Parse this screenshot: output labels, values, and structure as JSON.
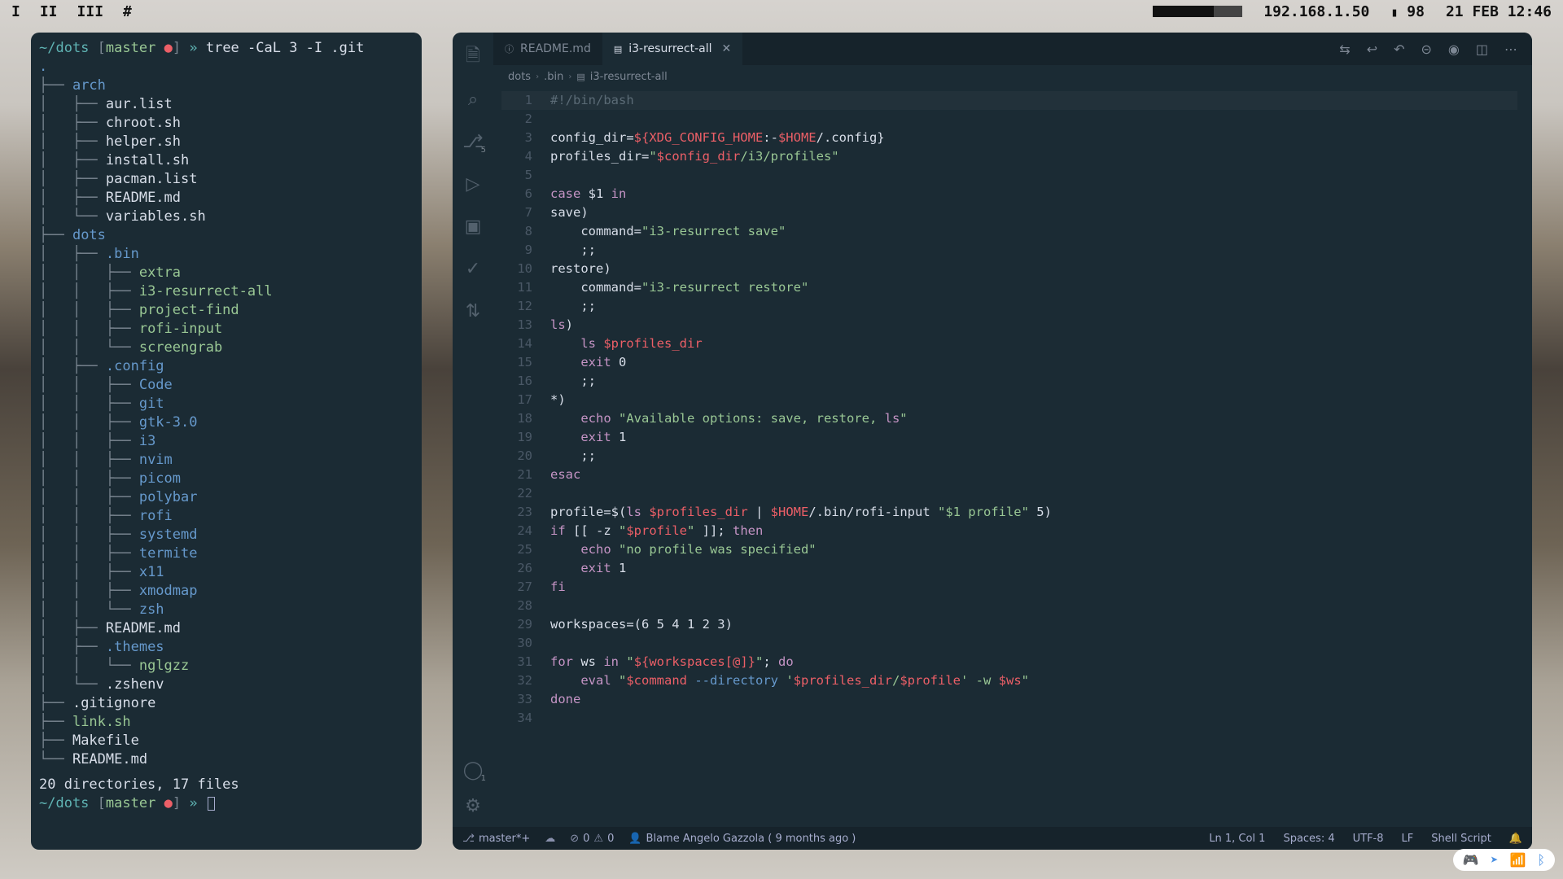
{
  "topbar": {
    "workspaces": [
      "I",
      "II",
      "III",
      "#"
    ],
    "ip": "192.168.1.50",
    "battery": "98",
    "datetime": "21 FEB 12:46"
  },
  "terminal": {
    "prompt_path": "~/dots",
    "branch": "master",
    "command": "tree -CaL 3 -I .git",
    "tree": [
      {
        "d": 0,
        "t": ".",
        "c": "blue"
      },
      {
        "d": 0,
        "t": "├── ",
        "c": "grey",
        "n": "arch",
        "nc": "blue"
      },
      {
        "d": 1,
        "t": "│   ├── ",
        "c": "grey",
        "n": "aur.list",
        "nc": "white"
      },
      {
        "d": 1,
        "t": "│   ├── ",
        "c": "grey",
        "n": "chroot.sh",
        "nc": "white"
      },
      {
        "d": 1,
        "t": "│   ├── ",
        "c": "grey",
        "n": "helper.sh",
        "nc": "white"
      },
      {
        "d": 1,
        "t": "│   ├── ",
        "c": "grey",
        "n": "install.sh",
        "nc": "white"
      },
      {
        "d": 1,
        "t": "│   ├── ",
        "c": "grey",
        "n": "pacman.list",
        "nc": "white"
      },
      {
        "d": 1,
        "t": "│   ├── ",
        "c": "grey",
        "n": "README.md",
        "nc": "white"
      },
      {
        "d": 1,
        "t": "│   └── ",
        "c": "grey",
        "n": "variables.sh",
        "nc": "white"
      },
      {
        "d": 0,
        "t": "├── ",
        "c": "grey",
        "n": "dots",
        "nc": "blue"
      },
      {
        "d": 1,
        "t": "│   ├── ",
        "c": "grey",
        "n": ".bin",
        "nc": "blue"
      },
      {
        "d": 2,
        "t": "│   │   ├── ",
        "c": "grey",
        "n": "extra",
        "nc": "green"
      },
      {
        "d": 2,
        "t": "│   │   ├── ",
        "c": "grey",
        "n": "i3-resurrect-all",
        "nc": "green"
      },
      {
        "d": 2,
        "t": "│   │   ├── ",
        "c": "grey",
        "n": "project-find",
        "nc": "green"
      },
      {
        "d": 2,
        "t": "│   │   ├── ",
        "c": "grey",
        "n": "rofi-input",
        "nc": "green"
      },
      {
        "d": 2,
        "t": "│   │   └── ",
        "c": "grey",
        "n": "screengrab",
        "nc": "green"
      },
      {
        "d": 1,
        "t": "│   ├── ",
        "c": "grey",
        "n": ".config",
        "nc": "blue"
      },
      {
        "d": 2,
        "t": "│   │   ├── ",
        "c": "grey",
        "n": "Code",
        "nc": "blue"
      },
      {
        "d": 2,
        "t": "│   │   ├── ",
        "c": "grey",
        "n": "git",
        "nc": "blue"
      },
      {
        "d": 2,
        "t": "│   │   ├── ",
        "c": "grey",
        "n": "gtk-3.0",
        "nc": "blue"
      },
      {
        "d": 2,
        "t": "│   │   ├── ",
        "c": "grey",
        "n": "i3",
        "nc": "blue"
      },
      {
        "d": 2,
        "t": "│   │   ├── ",
        "c": "grey",
        "n": "nvim",
        "nc": "blue"
      },
      {
        "d": 2,
        "t": "│   │   ├── ",
        "c": "grey",
        "n": "picom",
        "nc": "blue"
      },
      {
        "d": 2,
        "t": "│   │   ├── ",
        "c": "grey",
        "n": "polybar",
        "nc": "blue"
      },
      {
        "d": 2,
        "t": "│   │   ├── ",
        "c": "grey",
        "n": "rofi",
        "nc": "blue"
      },
      {
        "d": 2,
        "t": "│   │   ├── ",
        "c": "grey",
        "n": "systemd",
        "nc": "blue"
      },
      {
        "d": 2,
        "t": "│   │   ├── ",
        "c": "grey",
        "n": "termite",
        "nc": "blue"
      },
      {
        "d": 2,
        "t": "│   │   ├── ",
        "c": "grey",
        "n": "x11",
        "nc": "blue"
      },
      {
        "d": 2,
        "t": "│   │   ├── ",
        "c": "grey",
        "n": "xmodmap",
        "nc": "blue"
      },
      {
        "d": 2,
        "t": "│   │   └── ",
        "c": "grey",
        "n": "zsh",
        "nc": "blue"
      },
      {
        "d": 1,
        "t": "│   ├── ",
        "c": "grey",
        "n": "README.md",
        "nc": "white"
      },
      {
        "d": 1,
        "t": "│   ├── ",
        "c": "grey",
        "n": ".themes",
        "nc": "blue"
      },
      {
        "d": 2,
        "t": "│   │   └── ",
        "c": "grey",
        "n": "nglgzz",
        "nc": "green"
      },
      {
        "d": 1,
        "t": "│   └── ",
        "c": "grey",
        "n": ".zshenv",
        "nc": "white"
      },
      {
        "d": 0,
        "t": "├── ",
        "c": "grey",
        "n": ".gitignore",
        "nc": "white"
      },
      {
        "d": 0,
        "t": "├── ",
        "c": "grey",
        "n": "link.sh",
        "nc": "green"
      },
      {
        "d": 0,
        "t": "├── ",
        "c": "grey",
        "n": "Makefile",
        "nc": "white"
      },
      {
        "d": 0,
        "t": "└── ",
        "c": "grey",
        "n": "README.md",
        "nc": "white"
      }
    ],
    "summary": "20 directories, 17 files"
  },
  "editor": {
    "tabs": [
      {
        "label": "README.md",
        "active": false
      },
      {
        "label": "i3-resurrect-all",
        "active": true
      }
    ],
    "breadcrumb": [
      "dots",
      ".bin",
      "i3-resurrect-all"
    ],
    "scm_badge": "5",
    "account_badge": "1",
    "lines": [
      "#!/bin/bash",
      "",
      "config_dir=${XDG_CONFIG_HOME:-$HOME/.config}",
      "profiles_dir=\"$config_dir/i3/profiles\"",
      "",
      "case $1 in",
      "save)",
      "    command=\"i3-resurrect save\"",
      "    ;;",
      "restore)",
      "    command=\"i3-resurrect restore\"",
      "    ;;",
      "ls)",
      "    ls $profiles_dir",
      "    exit 0",
      "    ;;",
      "*)",
      "    echo \"Available options: save, restore, ls\"",
      "    exit 1",
      "    ;;",
      "esac",
      "",
      "profile=$(ls $profiles_dir | $HOME/.bin/rofi-input \"$1 profile\" 5)",
      "if [[ -z \"$profile\" ]]; then",
      "    echo \"no profile was specified\"",
      "    exit 1",
      "fi",
      "",
      "workspaces=(6 5 4 1 2 3)",
      "",
      "for ws in \"${workspaces[@]}\"; do",
      "    eval \"$command --directory '$profiles_dir/$profile' -w $ws\"",
      "done",
      ""
    ],
    "status": {
      "branch": "master*+",
      "errors": "0",
      "warnings": "0",
      "blame": "Blame Angelo Gazzola ( 9 months ago )",
      "pos": "Ln 1, Col 1",
      "spaces": "Spaces: 4",
      "encoding": "UTF-8",
      "eol": "LF",
      "lang": "Shell Script"
    }
  },
  "tray": {
    "items": [
      "discord",
      "telegram",
      "wifi",
      "bluetooth"
    ]
  }
}
